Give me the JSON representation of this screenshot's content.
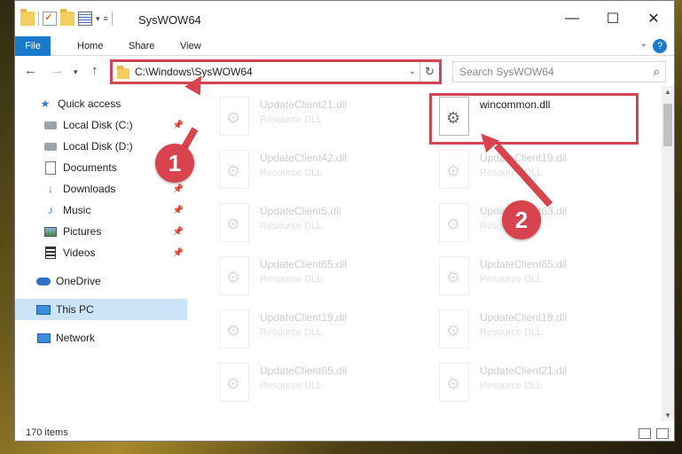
{
  "window": {
    "title": "SysWOW64",
    "controls": {
      "minimize": "—",
      "maximize": "☐",
      "close": "✕"
    }
  },
  "ribbon": {
    "tabs": [
      "File",
      "Home",
      "Share",
      "View"
    ],
    "help": "?"
  },
  "address": {
    "path": "C:\\Windows\\SysWOW64",
    "refresh": "↻",
    "dropdown": "⌄"
  },
  "search": {
    "placeholder": "Search SysWOW64",
    "icon": "search-icon"
  },
  "sidebar": {
    "items": [
      {
        "label": "Quick access",
        "icon": "star-icon"
      },
      {
        "label": "Local Disk (C:)",
        "icon": "drive-icon",
        "pinned": true
      },
      {
        "label": "Local Disk (D:)",
        "icon": "drive-icon"
      },
      {
        "label": "Documents",
        "icon": "documents-icon"
      },
      {
        "label": "Downloads",
        "icon": "download-icon",
        "pinned": true
      },
      {
        "label": "Music",
        "icon": "music-icon",
        "pinned": true
      },
      {
        "label": "Pictures",
        "icon": "pictures-icon",
        "pinned": true
      },
      {
        "label": "Videos",
        "icon": "videos-icon",
        "pinned": true
      },
      {
        "label": "OneDrive",
        "icon": "cloud-icon"
      },
      {
        "label": "This PC",
        "icon": "pc-icon",
        "selected": true
      },
      {
        "label": "Network",
        "icon": "network-icon"
      }
    ]
  },
  "files": [
    {
      "name": "UpdateClient21.dll",
      "type": "Resource DLL",
      "faded": true
    },
    {
      "name": "wincommon.dll",
      "type": "",
      "faded": false
    },
    {
      "name": "UpdateClient42.dll",
      "type": "Resource DLL",
      "faded": true
    },
    {
      "name": "UpdateClient19.dll",
      "type": "Resource DLL",
      "faded": true
    },
    {
      "name": "UpdateClient5.dll",
      "type": "Resource DLL",
      "faded": true
    },
    {
      "name": "UpdateClient63.dll",
      "type": "Resource DLL",
      "faded": true
    },
    {
      "name": "UpdateClient65.dll",
      "type": "Resource DLL",
      "faded": true
    },
    {
      "name": "UpdateClient65.dll",
      "type": "Resource DLL",
      "faded": true
    },
    {
      "name": "UpdateClient19.dll",
      "type": "Resource DLL",
      "faded": true
    },
    {
      "name": "UpdateClient19.dll",
      "type": "Resource DLL",
      "faded": true
    },
    {
      "name": "UpdateClient65.dll",
      "type": "Resource DLL",
      "faded": true
    },
    {
      "name": "UpdateClient21.dll",
      "type": "Resource DLL",
      "faded": true
    }
  ],
  "status": {
    "item_count": "170 items"
  },
  "callouts": [
    "1",
    "2"
  ],
  "colors": {
    "accent": "#1979ca",
    "highlight": "#d5454f",
    "selected": "#cce4f7"
  }
}
